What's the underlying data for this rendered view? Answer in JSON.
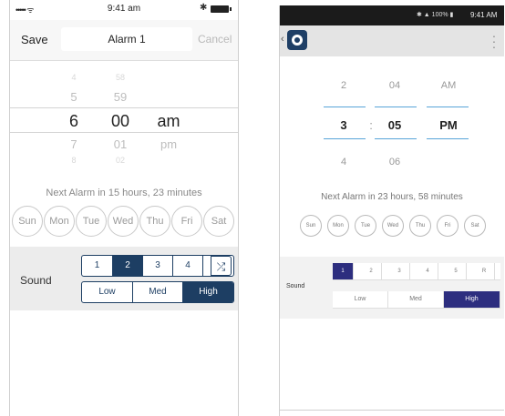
{
  "ios": {
    "status": {
      "time": "9:41 am",
      "signal": "••••• ᯤ"
    },
    "nav": {
      "save_label": "Save",
      "title_value": "Alarm 1",
      "cancel_label": "Cancel"
    },
    "picker": {
      "hours": [
        "4",
        "5",
        "6",
        "7",
        "8"
      ],
      "minutes": [
        "58",
        "59",
        "00",
        "01",
        "02"
      ],
      "meridiem": [
        "am",
        "pm"
      ],
      "selected_hour": "6",
      "selected_minute": "00",
      "selected_meridiem": "am"
    },
    "next_alarm": "Next Alarm in 15 hours, 23 minutes",
    "days": [
      "Sun",
      "Mon",
      "Tue",
      "Wed",
      "Thu",
      "Fri",
      "Sat"
    ],
    "sound": {
      "label": "Sound",
      "tones": [
        "1",
        "2",
        "3",
        "4",
        "5"
      ],
      "selected_tone": "2",
      "shuffle_icon": "shuffle-icon",
      "volumes": [
        "Low",
        "Med",
        "High"
      ],
      "selected_volume": "High"
    },
    "colors": {
      "accent": "#1d3e63"
    }
  },
  "android": {
    "status": {
      "icons": "✱ ▲ 100% ▮",
      "time": "9:41 AM"
    },
    "picker": {
      "hours": [
        "2",
        "3",
        "4"
      ],
      "minutes": [
        "04",
        "05",
        "06"
      ],
      "meridiem": [
        "AM",
        "PM"
      ],
      "separator": ":",
      "selected_hour": "3",
      "selected_minute": "05",
      "selected_meridiem": "PM"
    },
    "next_alarm": "Next Alarm in 23 hours, 58 minutes",
    "days": [
      "Sun",
      "Mon",
      "Tue",
      "Wed",
      "Thu",
      "Fri",
      "Sat"
    ],
    "sound": {
      "label": "Sound",
      "tones": [
        "1",
        "2",
        "3",
        "4",
        "5",
        "R"
      ],
      "selected_tone": "1",
      "volumes": [
        "Low",
        "Med",
        "High"
      ],
      "selected_volume": "High"
    },
    "colors": {
      "accent": "#2d2e7f",
      "picker_line": "#58a4d8"
    }
  }
}
